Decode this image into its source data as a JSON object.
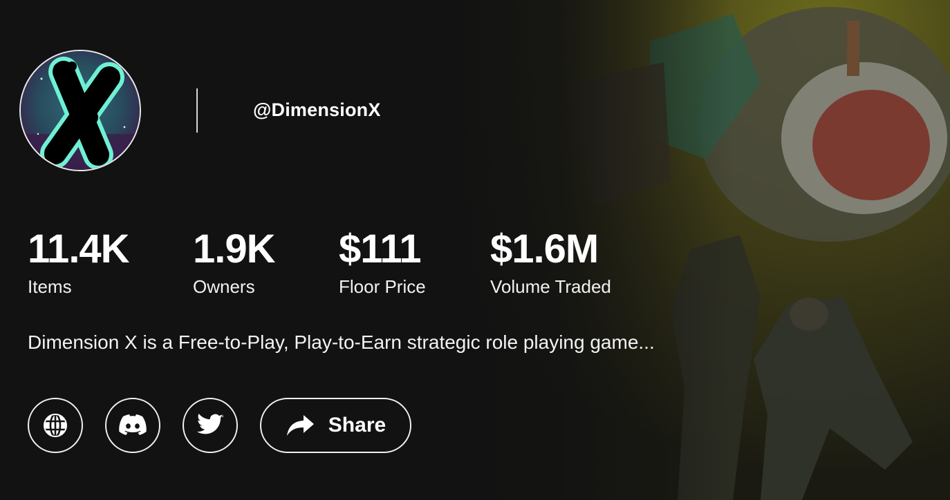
{
  "profile": {
    "handle": "@DimensionX",
    "avatar_icon": "dimension-x-logo"
  },
  "stats": [
    {
      "value": "11.4K",
      "label": "Items"
    },
    {
      "value": "1.9K",
      "label": "Owners"
    },
    {
      "value": "$111",
      "label": "Floor Price"
    },
    {
      "value": "$1.6M",
      "label": "Volume Traded"
    }
  ],
  "description": "Dimension X is a Free-to-Play, Play-to-Earn strategic role playing game...",
  "actions": {
    "website_icon": "globe-icon",
    "discord_icon": "discord-icon",
    "twitter_icon": "twitter-icon",
    "share_icon": "share-arrow-icon",
    "share_label": "Share"
  },
  "colors": {
    "background": "#121212",
    "text": "#ffffff",
    "accent_teal": "#5fe3c8"
  }
}
